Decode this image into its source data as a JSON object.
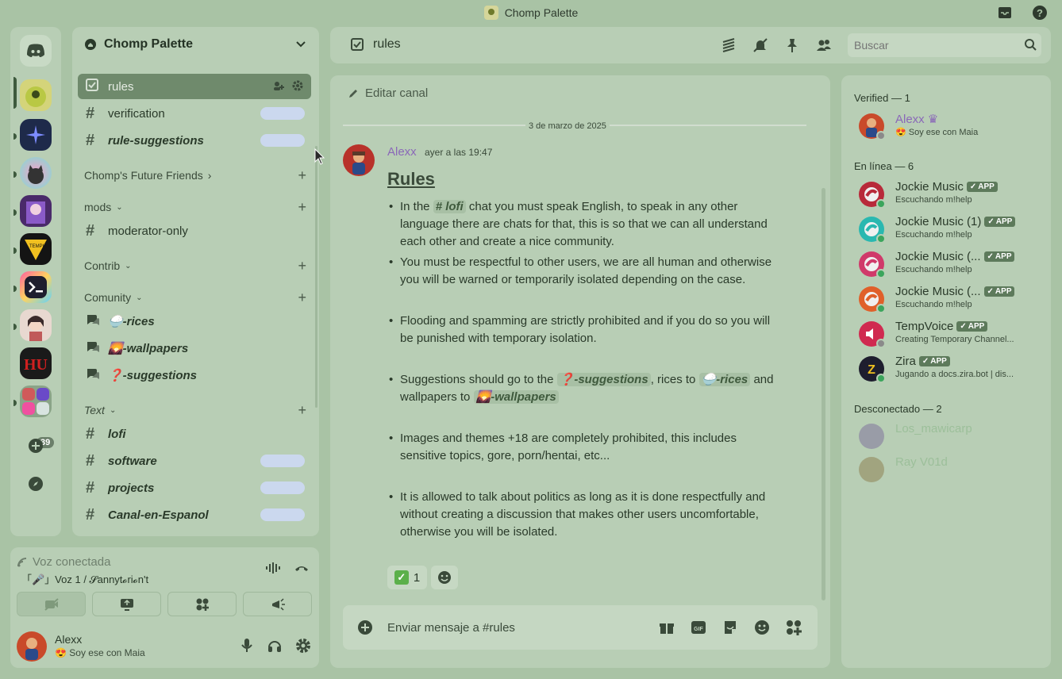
{
  "window": {
    "title": "Chomp Palette"
  },
  "server": {
    "name": "Chomp Palette",
    "badge_count": "39",
    "colors": {
      "accent": "#6f8a6c",
      "background": "#a9c3a5",
      "panel": "#b8ceb5"
    }
  },
  "channels": {
    "top": [
      {
        "name": "rules",
        "active": true
      },
      {
        "name": "verification"
      },
      {
        "name": "rule-suggestions"
      }
    ],
    "categories": [
      {
        "name": "Chomp's Future Friends"
      },
      {
        "name": "mods",
        "channels": [
          "moderator-only"
        ]
      },
      {
        "name": "Contrib"
      },
      {
        "name": "Comunity",
        "channels": [
          "🍚-rices",
          "🌄-wallpapers",
          "❓-suggestions"
        ]
      },
      {
        "name": "Text",
        "channels": [
          "lofi",
          "software",
          "projects",
          "Canal-en-Espanol"
        ]
      }
    ]
  },
  "voice": {
    "title": "Voz conectada",
    "channel": "「🎤」Voz 1 / 𝓢annyt𝓸ri𝓸n't"
  },
  "user": {
    "name": "Alexx",
    "status": "😍 Soy ese con Maia"
  },
  "header": {
    "channel": "rules",
    "search_placeholder": "Buscar"
  },
  "chat": {
    "edit_channel": "Editar canal",
    "date": "3 de marzo de 2025",
    "message": {
      "author": "Alexx",
      "time": "ayer a las 19:47",
      "heading": "Rules",
      "rules": {
        "r1_pre": "In the",
        "r1_mention": "# lofi",
        "r1_post": "chat you must speak English, to speak in any other language there are chats for that, this is so that we can all understand each other and create a nice community.",
        "r2": "You must be respectful to other users, we are all human and otherwise you will be warned or temporarily isolated depending on the case.",
        "r3": "Flooding and spamming are strictly prohibited and if you do so you will be punished with temporary isolation.",
        "r4_a": "Suggestions should go to the",
        "r4_m1": "❓-suggestions",
        "r4_b": ", rices to",
        "r4_m2": "🍚-rices",
        "r4_c": "and wallpapers to",
        "r4_m3": "🌄-wallpapers",
        "r5": "Images and themes +18 are completely prohibited, this includes sensitive topics, gore, porn/hentai, etc...",
        "r6": "It is allowed to talk about politics as long as it is done respectfully and without creating a discussion that makes other users uncomfortable, otherwise you will be isolated."
      },
      "reaction_count": "1"
    },
    "composer_placeholder": "Enviar mensaje a #rules"
  },
  "members": {
    "verified_header": "Verified — 1",
    "online_header": "En línea — 6",
    "offline_header": "Desconectado — 2",
    "app_tag": "APP",
    "verified": [
      {
        "name": "Alexx",
        "status": "😍 Soy ese con Maia"
      }
    ],
    "online": [
      {
        "name": "Jockie Music",
        "status": "Escuchando m!help"
      },
      {
        "name": "Jockie Music (1)",
        "status": "Escuchando m!help"
      },
      {
        "name": "Jockie Music (...",
        "status": "Escuchando m!help"
      },
      {
        "name": "Jockie Music (...",
        "status": "Escuchando m!help"
      },
      {
        "name": "TempVoice",
        "status": "Creating Temporary Channel..."
      },
      {
        "name": "Zira",
        "status": "Jugando a docs.zira.bot | dis..."
      }
    ],
    "offline": [
      {
        "name": "Los_mawicarp"
      },
      {
        "name": "Ray V01d"
      }
    ]
  }
}
